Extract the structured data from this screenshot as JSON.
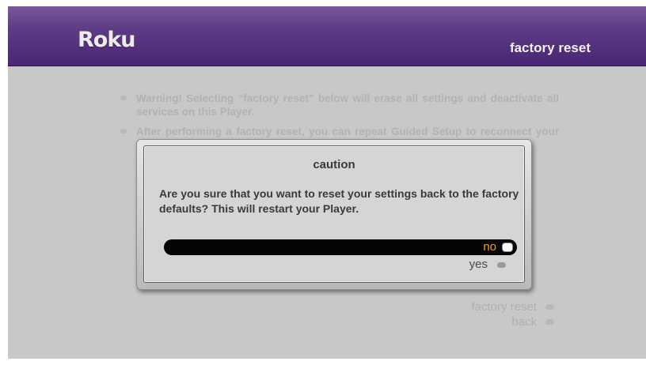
{
  "header": {
    "logo": "Roku",
    "title": "factory reset"
  },
  "background": {
    "items": [
      "Warning! Selecting “factory reset” below will erase all settings and deactivate all services on this Player.",
      "After performing a factory reset, you can repeat Guided Setup to reconnect your Player to your network and reactivate the services that you want to use."
    ],
    "menu": [
      "factory reset",
      "back"
    ]
  },
  "dialog": {
    "title": "caution",
    "message": "Are you sure that you want to reset your settings back to the factory defaults? This will restart your Player.",
    "options": [
      {
        "label": "no",
        "selected": true
      },
      {
        "label": "yes",
        "selected": false
      }
    ]
  },
  "colors": {
    "header": "#4a2673",
    "highlight": "#f0a020",
    "background": "#c8c8c8"
  }
}
